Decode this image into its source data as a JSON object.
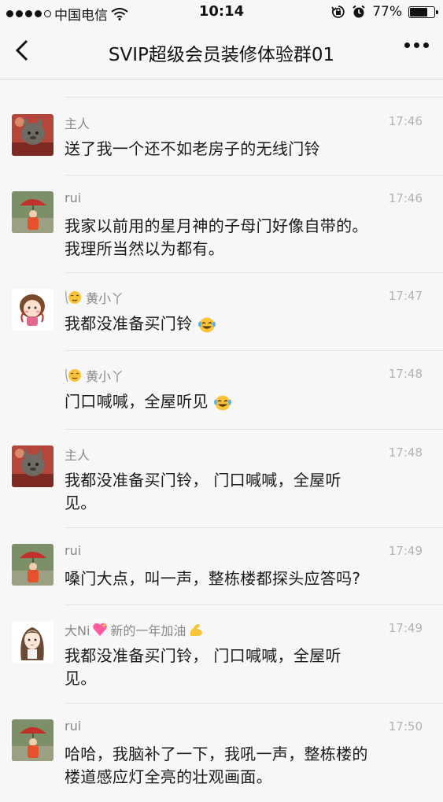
{
  "status_bar": {
    "carrier": "中国电信",
    "time": "10:14",
    "battery_text": "77%",
    "battery_level": 0.77
  },
  "nav": {
    "title": "SVIP超级会员装修体验群01"
  },
  "colors": {
    "background": "#f7f7f7",
    "name": "#888888",
    "time": "#b2b2b2",
    "text": "#1a1a1a"
  },
  "messages": [
    {
      "name": "主人",
      "time": "17:46",
      "lines": [
        "送了我一个还不如老房子的无线门铃"
      ]
    },
    {
      "name": "rui",
      "time": "17:46",
      "lines": [
        "我家以前用的星月神的子母门好像自带的。",
        "我理所当然以为都有。"
      ]
    },
    {
      "name": "黄小丫",
      "time": "17:47",
      "lines": [
        "我都没准备买门铃"
      ]
    },
    {
      "name": "黄小丫",
      "time": "17:48",
      "lines": [
        "门口喊喊，全屋听见"
      ]
    },
    {
      "name": "主人",
      "time": "17:48",
      "lines": [
        "我都没准备买门铃， 门口喊喊，全屋听",
        "见。"
      ]
    },
    {
      "name": "rui",
      "time": "17:49",
      "lines": [
        "嗓门大点，叫一声，整栋楼都探头应答吗?"
      ]
    },
    {
      "name": "大Ni",
      "name_suffix": "新的一年加油",
      "time": "17:49",
      "lines": [
        "我都没准备买门铃， 门口喊喊，全屋听",
        "见。"
      ]
    },
    {
      "name": "rui",
      "time": "17:50",
      "lines": [
        "哈哈，我脑补了一下，我吼一声，整栋楼的",
        "楼道感应灯全亮的壮观画面。"
      ]
    }
  ]
}
